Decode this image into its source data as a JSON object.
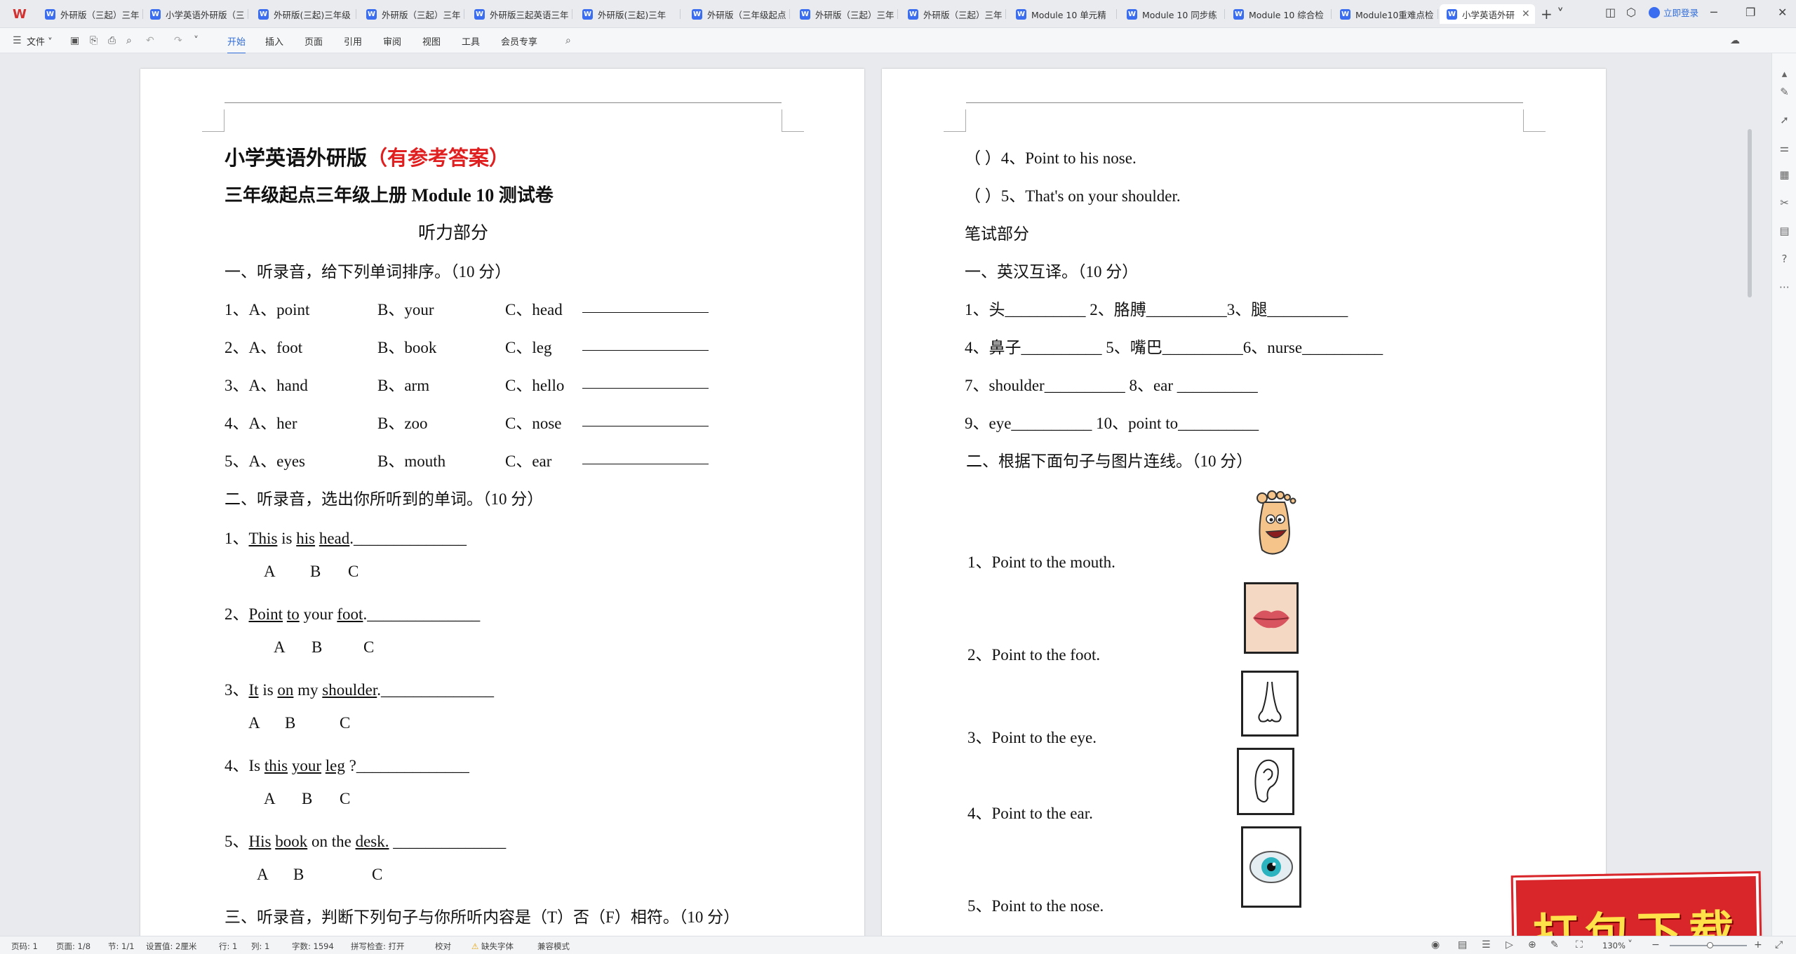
{
  "tabs": [
    {
      "label": "外研版（三起）三年"
    },
    {
      "label": "小学英语外研版（三"
    },
    {
      "label": "外研版(三起)三年级"
    },
    {
      "label": "外研版（三起）三年"
    },
    {
      "label": "外研版三起英语三年"
    },
    {
      "label": "外研版(三起)三年"
    },
    {
      "label": "外研版（三年级起点"
    },
    {
      "label": "外研版（三起）三年"
    },
    {
      "label": "外研版（三起）三年"
    },
    {
      "label": "Module 10 单元精"
    },
    {
      "label": "Module 10 同步练"
    },
    {
      "label": "Module 10 综合检"
    },
    {
      "label": "Module10重难点检"
    },
    {
      "label": "小学英语外研"
    }
  ],
  "titlebar": {
    "login": "立即登录"
  },
  "ribbon": {
    "file": "文件",
    "menus": [
      "开始",
      "插入",
      "页面",
      "引用",
      "审阅",
      "视图",
      "工具",
      "会员专享"
    ],
    "share": "分享"
  },
  "page1": {
    "title_black": "小学英语外研版",
    "title_red": "（有参考答案）",
    "subtitle": "三年级起点三年级上册 Module 10 测试卷",
    "listening": "听力部分",
    "sec1": "一、听录音，给下列单词排序。（10 分）",
    "q1": [
      {
        "n": "1、A、point",
        "b": "B、your",
        "c": "C、head"
      },
      {
        "n": "2、A、foot",
        "b": "B、book",
        "c": "C、leg"
      },
      {
        "n": "3、A、hand",
        "b": "B、arm",
        "c": "C、hello"
      },
      {
        "n": "4、A、her",
        "b": "B、zoo",
        "c": "C、nose"
      },
      {
        "n": "5、A、eyes",
        "b": "B、mouth",
        "c": "C、ear"
      }
    ],
    "sec2": "二、听录音，选出你所听到的单词。（10 分）",
    "s1": {
      "n": "1、",
      "w1": "This",
      "t1": " is ",
      "w2": "his",
      "t2": " ",
      "w3": "head",
      "t3": ".______________"
    },
    "s2": {
      "n": "2、",
      "w1": "Point",
      "t1": " ",
      "w2": "to",
      "t2": " your ",
      "w3": "foot",
      "t3": ".______________"
    },
    "s3": {
      "n": "3、",
      "w1": "It",
      "t1": " is ",
      "w2": "on",
      "t2": " my ",
      "w3": "shoulder",
      "t3": ".______________"
    },
    "s4": {
      "n": "4、Is ",
      "w1": "this",
      "t1": " ",
      "w2": "your",
      "t2": " ",
      "w3": "leg",
      "t3": " ?______________"
    },
    "s5": {
      "n": "5、",
      "w1": "His",
      "t1": " ",
      "w2": "book",
      "t2": " on the ",
      "w3": "desk.",
      "t3": " ______________"
    },
    "opts": [
      "A",
      "B",
      "C"
    ],
    "sec3": "三、听录音，判断下列句子与你所听内容是（T）否（F）相符。（10 分）"
  },
  "page2": {
    "tf4": "（        ）4、Point to his nose.",
    "tf5": "（        ）5、That's on your shoulder.",
    "written": "笔试部分",
    "sec1": "一、英汉互译。（10 分）",
    "r1": "1、头__________    2、胳膊__________3、腿__________",
    "r2": "4、鼻子__________  5、嘴巴__________6、nurse__________",
    "r3": "7、shoulder__________   8、ear __________",
    "r4": "9、eye__________          10、point to__________",
    "sec2": "二、根据下面句子与图片连线。（10 分）",
    "m": [
      "1、Point to the mouth.",
      "2、Point to the foot.",
      "3、Point to the eye.",
      "4、Point to the ear.",
      "5、Point to the nose."
    ]
  },
  "badge": "打包下载",
  "status": {
    "page": "页码: 1",
    "pages": "页面: 1/8",
    "section": "节: 1/1",
    "setting": "设置值: 2厘米",
    "row": "行: 1",
    "col": "列: 1",
    "words": "字数: 1594",
    "spell": "拼写检查: 打开",
    "proof": "校对",
    "font": "缺失字体",
    "compat": "兼容模式",
    "zoom": "130%"
  }
}
